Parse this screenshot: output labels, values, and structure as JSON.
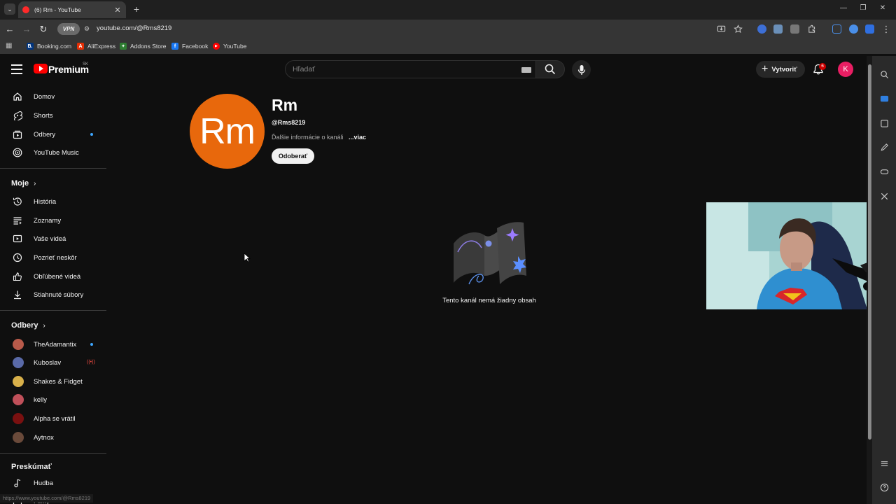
{
  "browser": {
    "tab_title": "(6) Rm - YouTube",
    "url": "youtube.com/@Rms8219",
    "vpn_label": "VPN",
    "bookmarks": [
      {
        "label": "Booking.com",
        "color": "#003580",
        "glyph": "B."
      },
      {
        "label": "AliExpress",
        "color": "#e62e04",
        "glyph": "A"
      },
      {
        "label": "Addons Store",
        "color": "#2e7d32",
        "glyph": "✦"
      },
      {
        "label": "Facebook",
        "color": "#1877f2",
        "glyph": "f"
      },
      {
        "label": "YouTube",
        "color": "#ff0000",
        "glyph": "▶"
      }
    ],
    "status_url": "https://www.youtube.com/@Rms8219"
  },
  "masthead": {
    "brand": "Premium",
    "country_code": "SK",
    "search_placeholder": "Hľadať",
    "create_label": "Vytvoriť",
    "notification_count": "6",
    "account_initial": "K"
  },
  "sidebar": {
    "main": [
      {
        "label": "Domov",
        "icon": "home-icon"
      },
      {
        "label": "Shorts",
        "icon": "shorts-icon"
      },
      {
        "label": "Odbery",
        "icon": "subscriptions-icon"
      },
      {
        "label": "YouTube Music",
        "icon": "music-icon"
      }
    ],
    "you_heading": "Moje",
    "you": [
      {
        "label": "História",
        "icon": "history-icon"
      },
      {
        "label": "Zoznamy",
        "icon": "playlists-icon"
      },
      {
        "label": "Vaše videá",
        "icon": "your-videos-icon"
      },
      {
        "label": "Pozrieť neskôr",
        "icon": "watch-later-icon"
      },
      {
        "label": "Obľúbené videá",
        "icon": "liked-icon"
      },
      {
        "label": "Stiahnuté súbory",
        "icon": "downloads-icon"
      }
    ],
    "subs_heading": "Odbery",
    "subscriptions": [
      {
        "label": "TheAdamantix",
        "color": "#b85a4a"
      },
      {
        "label": "Kuboslav",
        "color": "#5a6aa8"
      },
      {
        "label": "Shakes & Fidget",
        "color": "#d8b04a"
      },
      {
        "label": "kelly",
        "color": "#c0505a"
      },
      {
        "label": "Alpha se vrátil",
        "color": "#7a1010"
      },
      {
        "label": "Aytnox",
        "color": "#6a4a3a"
      }
    ],
    "explore_heading": "Preskúmať",
    "explore": [
      {
        "label": "Hudba",
        "icon": "music-note-icon"
      },
      {
        "label": "Filmy",
        "icon": "movies-icon"
      }
    ]
  },
  "channel": {
    "avatar_text": "Rm",
    "name": "Rm",
    "handle": "@Rms8219",
    "about": "Ďalšie informácie o kanáli",
    "more": "...viac",
    "subscribe_label": "Odoberať",
    "empty_message": "Tento kanál nemá žiadny obsah"
  }
}
